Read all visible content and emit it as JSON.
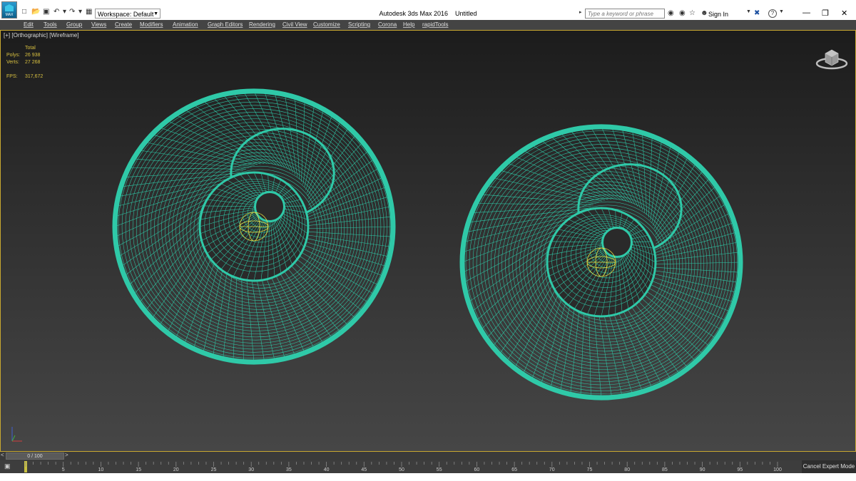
{
  "window": {
    "logo_text": "MAX",
    "title": "Autodesk 3ds Max 2016    Untitled",
    "workspace": "Workspace: Default",
    "search_placeholder": "Type a keyword or phrase",
    "sign_in": "Sign In",
    "help_icon": "?"
  },
  "menu": {
    "items": [
      "Edit",
      "Tools",
      "Group",
      "Views",
      "Create",
      "Modifiers",
      "Animation",
      "Graph Editors",
      "Rendering",
      "Civil View",
      "Customize",
      "Scripting",
      "Corona",
      "Help",
      "rapidTools"
    ]
  },
  "viewport": {
    "label": "[+] [Orthographic] [Wireframe]",
    "stats": {
      "total_label": "Total",
      "polys_label": "Polys:",
      "polys_value": "26 938",
      "verts_label": "Verts:",
      "verts_value": "27 268",
      "fps_label": "FPS:",
      "fps_value": "317,672"
    },
    "wire_color": "#2fc9a8",
    "highlight_color": "#e8e040",
    "border_color": "#c8a830"
  },
  "timeline": {
    "slider_label": "0 / 100",
    "prev_arrow": "<",
    "next_arrow": ">",
    "ticks": [
      "5",
      "10",
      "15",
      "20",
      "25",
      "30",
      "35",
      "40",
      "45",
      "50",
      "55",
      "60",
      "65",
      "70",
      "75",
      "80",
      "85",
      "90",
      "95",
      "100"
    ],
    "cancel_mode": "Cancel Expert Mode"
  }
}
